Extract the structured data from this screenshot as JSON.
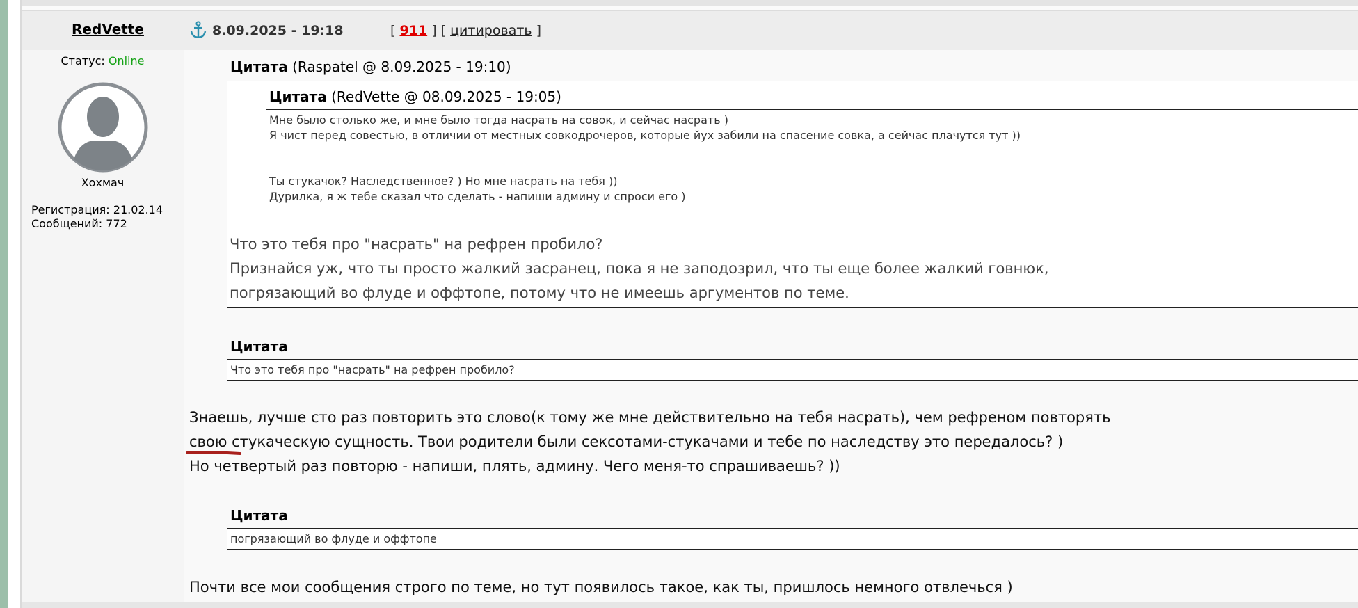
{
  "post": {
    "author": "RedVette",
    "date": "8.09.2025 - 19:18",
    "links": {
      "open": "[",
      "post_number": "911",
      "mid": "] [",
      "quote_label": "цитировать",
      "close": "]"
    }
  },
  "profile": {
    "status_label": "Статус:",
    "status_value": "Online",
    "rank": "Хохмач",
    "registration": "Регистрация: 21.02.14",
    "messages": "Сообщений: 772"
  },
  "colors": {
    "online": "#16a316",
    "post_number": "#e00000",
    "left_stripe": "#9cbfaa"
  },
  "quote1": {
    "label": "Цитата",
    "source": "(Raspatel @ 8.09.2025 - 19:10)",
    "nested": {
      "label": "Цитата",
      "source": "(RedVette @ 08.09.2025 - 19:05)",
      "lines": [
        "Мне было столько же, и мне было тогда насрать на совок, и сейчас насрать )",
        "Я чист перед совестью, в отличии от местных совкодрочеров, которые йух забили на спасение совка, а сейчас плачутся тут ))",
        "",
        "",
        "Ты стукачок? Наследственное? ) Но мне насрать на тебя ))",
        "Дурилка, я ж тебе сказал что сделать - напиши админу и спроси его )"
      ]
    },
    "lines": [
      "Что это тебя про \"насрать\" на рефрен пробило?",
      "Признайся уж, что ты просто жалкий засранец, пока я не заподозрил, что ты еще более жалкий говнюк,",
      "погрязающий во флуде и оффтопе, потому что не имеешь аргументов по теме."
    ]
  },
  "quote2": {
    "label": "Цитата",
    "text": "Что это тебя про \"насрать\" на рефрен пробило?"
  },
  "reply1": [
    "Знаешь, лучше сто раз повторить это слово(к тому же мне действительно на тебя насрать), чем рефреном повторять",
    "свою стукаческую сущность. Твои родители были сексотами-стукачами и тебе по наследству это передалось? )",
    "Но четвертый раз повторю - напиши, плять, админу. Чего меня-то спрашиваешь? ))"
  ],
  "quote3": {
    "label": "Цитата",
    "text": "погрязающий во флуде и оффтопе"
  },
  "reply2": "Почти все мои сообщения строго по теме, но тут появилось такое, как ты, пришлось немного отвлечься )"
}
